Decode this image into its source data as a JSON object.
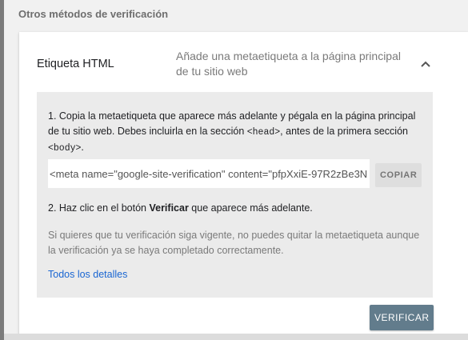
{
  "section": {
    "title": "Otros métodos de verificación"
  },
  "method": {
    "label": "Etiqueta HTML",
    "description": "Añade una metaetiqueta a la página principal de tu sitio web",
    "expand_icon": "chevron-up-icon"
  },
  "instructions": {
    "step1_text": "1. Copia la metaetiqueta que aparece más adelante y pégala en la página principal de tu sitio web. Debes incluirla en la sección ",
    "step1_head_tag": "<head>",
    "step1_middle": ", antes de la primera sección ",
    "step1_body_tag": "<body>",
    "step1_end": ".",
    "meta_tag_value": "<meta name=\"google-site-verification\" content=\"pfpXxiE-97R2zBe3N",
    "copy_label": "COPIAR",
    "step2_prefix": "2. Haz clic en el botón ",
    "step2_bold": "Verificar",
    "step2_suffix": " que aparece más adelante.",
    "note": "Si quieres que tu verificación siga vigente, no puedes quitar la metaetiqueta aunque la verificación ya se haya completado correctamente.",
    "details_link": "Todos los detalles"
  },
  "actions": {
    "verify_label": "VERIFICAR"
  },
  "colors": {
    "background": "#f1f1f1",
    "panel": "#ebebeb",
    "link": "#1a66d2",
    "verify_button": "#627c8c"
  }
}
